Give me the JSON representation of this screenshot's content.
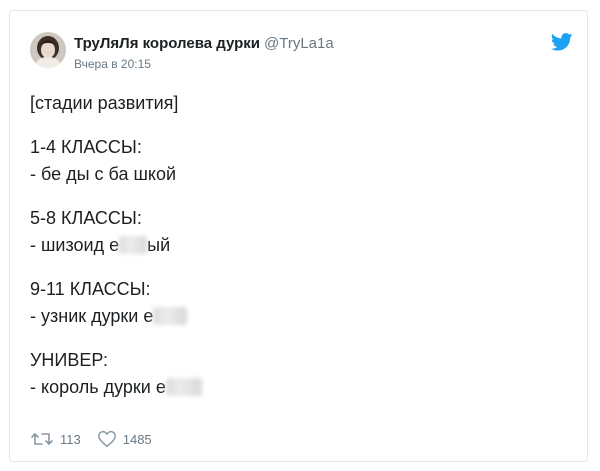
{
  "tweet": {
    "author_name": "ТруЛяЛя королева дурки",
    "author_handle": "@TryLa1a",
    "timestamp": "Вчера в 20:15",
    "lines": {
      "l1": "[стадии развития]",
      "l2": "1-4 КЛАССЫ:",
      "l3": "- бе ды с ба шкой",
      "l4": "5-8 КЛАССЫ:",
      "l5a": "- шизоид е",
      "l5b": "ый",
      "l6": "9-11 КЛАССЫ:",
      "l7": "- узник дурки е",
      "l8": "УНИВЕР:",
      "l9": "- король дурки е"
    },
    "retweet_count": "113",
    "like_count": "1485"
  },
  "icons": {
    "brand": "twitter-bird-icon",
    "retweet": "retweet-icon",
    "like": "heart-icon"
  },
  "colors": {
    "brand_blue": "#1da1f2",
    "meta_gray": "#697882",
    "text": "#1c2022",
    "border": "#e1e8ed"
  }
}
